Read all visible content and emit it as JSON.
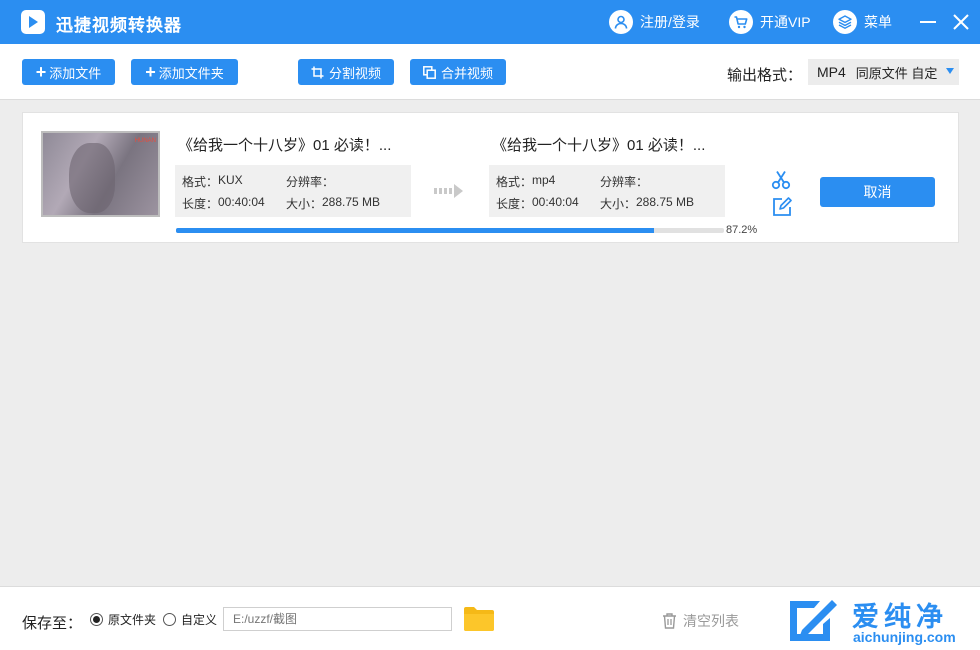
{
  "app": {
    "title": "迅捷视频转换器",
    "login": "注册/登录",
    "vip": "开通VIP",
    "menu": "菜单",
    "accent_color": "#2b8ef1"
  },
  "toolbar": {
    "add_file": "添加文件",
    "add_folder": "添加文件夹",
    "split_video": "分割视频",
    "merge_video": "合并视频",
    "output_format_label": "输出格式：",
    "output_format_value": "MP4",
    "output_format_sub": "同原文件 自定"
  },
  "item": {
    "source": {
      "name": "《给我一个十八岁》01 必读！...",
      "format_label": "格式：",
      "format": "KUX",
      "resolution_label": "分辨率：",
      "resolution": "",
      "duration_label": "长度：",
      "duration": "00:40:04",
      "size_label": "大小：",
      "size": "288.75 MB"
    },
    "target": {
      "name": "《给我一个十八岁》01 必读！...",
      "format_label": "格式：",
      "format": "mp4",
      "resolution_label": "分辨率：",
      "resolution": "",
      "duration_label": "长度：",
      "duration": "00:40:04",
      "size_label": "大小：",
      "size": "288.75 MB"
    },
    "thumb_mark": "HUNAN",
    "progress": 0.872,
    "progress_text": "87.2%",
    "cancel": "取消"
  },
  "bottom": {
    "save_to": "保存至：",
    "radio_original": "原文件夹",
    "radio_custom": "自定义",
    "selected": "original",
    "path_placeholder": "E:/uzzf/截图",
    "clear_list": "清空列表"
  },
  "watermark": {
    "cn": "爱纯净",
    "en": "aichunjing.com"
  },
  "icons": [
    "app-logo",
    "user-icon",
    "cart-icon",
    "layers-icon",
    "minimize-icon",
    "close-icon",
    "crop-icon",
    "merge-icon",
    "arrow-right-icon",
    "scissors-icon",
    "edit-icon",
    "folder-icon",
    "trash-icon"
  ]
}
